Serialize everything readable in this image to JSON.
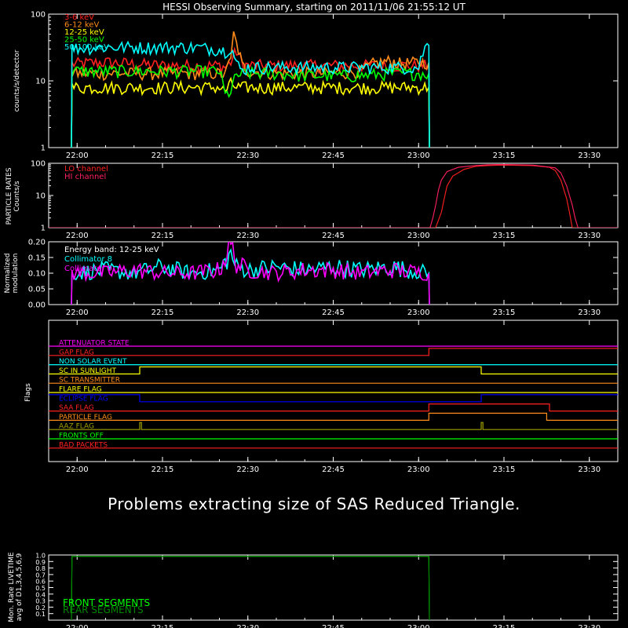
{
  "title": "HESSI Observing Summary, starting on 2011/11/06 21:55:12 UT",
  "message": "Problems extracting size of SAS Reduced Triangle.",
  "time_axis": {
    "start": "21:55:12",
    "ticks": [
      "22:00",
      "22:15",
      "22:30",
      "22:45",
      "23:00",
      "23:15",
      "23:30"
    ]
  },
  "colors": {
    "background": "#000000",
    "axes": "#ffffff",
    "red": "#ff2020",
    "orange": "#ff8c1a",
    "yellow": "#ffff00",
    "green": "#00ff00",
    "cyan": "#00ffff",
    "magenta": "#ff00ff",
    "blue": "#0000ff",
    "olive": "#a0a000"
  },
  "chart_data": [
    {
      "id": "count-rates",
      "type": "line",
      "ylabel": "counts/s/detector",
      "yscale": "log",
      "ylim": [
        1,
        100
      ],
      "yticks": [
        "1",
        "10",
        "100"
      ],
      "x_unit": "minutes after 22:00",
      "series": [
        {
          "name": "3-6 keV",
          "color": "#ff2020",
          "points": [
            [
              -1.0,
              1
            ],
            [
              -0.9,
              18
            ],
            [
              5,
              19
            ],
            [
              10,
              18
            ],
            [
              15,
              17
            ],
            [
              20,
              17
            ],
            [
              25,
              17
            ],
            [
              26,
              16
            ],
            [
              27,
              19
            ],
            [
              28,
              28
            ],
            [
              29,
              18
            ],
            [
              30,
              17
            ],
            [
              35,
              17
            ],
            [
              40,
              17
            ],
            [
              45,
              17
            ],
            [
              50,
              17
            ],
            [
              55,
              17
            ],
            [
              60,
              17
            ],
            [
              61.8,
              17
            ],
            [
              61.9,
              1
            ]
          ]
        },
        {
          "name": "6-12 keV",
          "color": "#ff8c1a",
          "points": [
            [
              -1.0,
              1
            ],
            [
              -0.9,
              13
            ],
            [
              5,
              13
            ],
            [
              10,
              13
            ],
            [
              15,
              13
            ],
            [
              20,
              13
            ],
            [
              25,
              13
            ],
            [
              26,
              12
            ],
            [
              27,
              22
            ],
            [
              27.5,
              55
            ],
            [
              28,
              35
            ],
            [
              29,
              17
            ],
            [
              30,
              14
            ],
            [
              35,
              13
            ],
            [
              40,
              13
            ],
            [
              45,
              13
            ],
            [
              50,
              14
            ],
            [
              52,
              18
            ],
            [
              55,
              20
            ],
            [
              57,
              18
            ],
            [
              60,
              19
            ],
            [
              61.8,
              19
            ],
            [
              61.9,
              1
            ]
          ]
        },
        {
          "name": "12-25 keV",
          "color": "#ffff00",
          "points": [
            [
              -1.0,
              1
            ],
            [
              -0.9,
              8
            ],
            [
              5,
              8
            ],
            [
              10,
              8
            ],
            [
              15,
              8
            ],
            [
              20,
              8
            ],
            [
              25,
              8
            ],
            [
              26,
              7
            ],
            [
              27,
              9
            ],
            [
              28,
              8
            ],
            [
              30,
              8
            ],
            [
              35,
              8
            ],
            [
              40,
              8
            ],
            [
              45,
              8
            ],
            [
              50,
              8
            ],
            [
              55,
              8
            ],
            [
              60,
              8
            ],
            [
              61.8,
              8
            ],
            [
              61.9,
              1
            ]
          ]
        },
        {
          "name": "25-50 keV",
          "color": "#00ff00",
          "points": [
            [
              -1.0,
              1
            ],
            [
              -0.9,
              14
            ],
            [
              5,
              14
            ],
            [
              10,
              14
            ],
            [
              15,
              14
            ],
            [
              20,
              14
            ],
            [
              25,
              14
            ],
            [
              26,
              6
            ],
            [
              27,
              7
            ],
            [
              28,
              12
            ],
            [
              30,
              13
            ],
            [
              35,
              13
            ],
            [
              40,
              12
            ],
            [
              45,
              12
            ],
            [
              50,
              12
            ],
            [
              55,
              13
            ],
            [
              60,
              13
            ],
            [
              61.8,
              13
            ],
            [
              61.9,
              1
            ]
          ]
        },
        {
          "name": "50-100 keV",
          "color": "#00ffff",
          "points": [
            [
              -1.0,
              1
            ],
            [
              -0.9,
              31
            ],
            [
              5,
              32
            ],
            [
              10,
              32
            ],
            [
              15,
              32
            ],
            [
              20,
              32
            ],
            [
              25,
              30
            ],
            [
              26,
              28
            ],
            [
              27,
              32
            ],
            [
              28,
              18
            ],
            [
              29,
              14
            ],
            [
              30,
              16
            ],
            [
              35,
              16
            ],
            [
              40,
              16
            ],
            [
              45,
              16
            ],
            [
              50,
              16
            ],
            [
              55,
              16
            ],
            [
              60,
              16
            ],
            [
              61.5,
              36
            ],
            [
              61.8,
              34
            ],
            [
              61.9,
              1
            ]
          ]
        }
      ]
    },
    {
      "id": "particle-rates",
      "type": "line",
      "ylabel": "PARTICLE RATES\nCounts/s",
      "yscale": "log",
      "ylim": [
        1,
        100
      ],
      "yticks": [
        "1",
        "10",
        "100"
      ],
      "x_unit": "minutes after 22:00",
      "series": [
        {
          "name": "LO channel",
          "color": "#ff2020",
          "points": [
            [
              -5,
              1
            ],
            [
              63,
              1
            ],
            [
              64,
              3
            ],
            [
              64.5,
              8
            ],
            [
              65,
              20
            ],
            [
              66,
              40
            ],
            [
              68,
              65
            ],
            [
              70,
              80
            ],
            [
              72,
              85
            ],
            [
              75,
              88
            ],
            [
              80,
              85
            ],
            [
              83,
              75
            ],
            [
              84,
              60
            ],
            [
              85,
              30
            ],
            [
              86,
              8
            ],
            [
              86.5,
              3
            ],
            [
              87,
              1
            ],
            [
              95,
              1
            ]
          ]
        },
        {
          "name": "HI channel",
          "color": "#ff2060",
          "points": [
            [
              -5,
              1
            ],
            [
              62,
              1
            ],
            [
              62.5,
              2
            ],
            [
              63,
              5
            ],
            [
              63.5,
              15
            ],
            [
              64,
              30
            ],
            [
              65,
              55
            ],
            [
              67,
              75
            ],
            [
              70,
              85
            ],
            [
              72,
              90
            ],
            [
              75,
              92
            ],
            [
              80,
              88
            ],
            [
              84,
              72
            ],
            [
              85,
              50
            ],
            [
              86,
              20
            ],
            [
              87,
              5
            ],
            [
              87.5,
              2
            ],
            [
              88,
              1
            ],
            [
              95,
              1
            ]
          ]
        }
      ]
    },
    {
      "id": "modulation",
      "type": "line",
      "ylabel": "Normalized\nmodulation",
      "ylim": [
        0,
        0.2
      ],
      "yticks": [
        "0.00",
        "0.05",
        "0.10",
        "0.15",
        "0.20"
      ],
      "annotation": "Energy band: 12-25 keV",
      "x_unit": "minutes after 22:00",
      "series": [
        {
          "name": "Collimator 8",
          "color": "#00ffff",
          "points": [
            [
              -1.0,
              0
            ],
            [
              -0.9,
              0.1
            ],
            [
              5,
              0.11
            ],
            [
              10,
              0.1
            ],
            [
              15,
              0.12
            ],
            [
              20,
              0.1
            ],
            [
              25,
              0.11
            ],
            [
              27,
              0.16
            ],
            [
              28,
              0.12
            ],
            [
              30,
              0.11
            ],
            [
              35,
              0.12
            ],
            [
              40,
              0.11
            ],
            [
              45,
              0.12
            ],
            [
              50,
              0.11
            ],
            [
              55,
              0.12
            ],
            [
              61.8,
              0.1
            ],
            [
              61.9,
              0
            ]
          ]
        },
        {
          "name": "Collimator 9",
          "color": "#ff00ff",
          "points": [
            [
              -1.0,
              0
            ],
            [
              -0.9,
              0.1
            ],
            [
              5,
              0.1
            ],
            [
              10,
              0.11
            ],
            [
              15,
              0.1
            ],
            [
              20,
              0.1
            ],
            [
              25,
              0.11
            ],
            [
              27,
              0.19
            ],
            [
              28,
              0.13
            ],
            [
              30,
              0.11
            ],
            [
              35,
              0.1
            ],
            [
              40,
              0.11
            ],
            [
              45,
              0.11
            ],
            [
              50,
              0.1
            ],
            [
              55,
              0.11
            ],
            [
              61.8,
              0.1
            ],
            [
              61.9,
              0
            ]
          ]
        }
      ]
    },
    {
      "id": "flags",
      "type": "line",
      "ylabel": "Flags",
      "x_unit": "minutes after 22:00",
      "series": [
        {
          "name": "ATTENUATOR STATE",
          "color": "#ff00ff",
          "points": [
            [
              -5,
              0
            ],
            [
              95,
              0
            ]
          ]
        },
        {
          "name": "GAP FLAG",
          "color": "#ff2020",
          "points": [
            [
              -5,
              0
            ],
            [
              61.8,
              0
            ],
            [
              61.8,
              1
            ],
            [
              95,
              1
            ]
          ]
        },
        {
          "name": "NON SOLAR EVENT",
          "color": "#00ffff",
          "points": [
            [
              -5,
              0
            ],
            [
              95,
              0
            ]
          ]
        },
        {
          "name": "SC IN SUNLIGHT",
          "color": "#ffff00",
          "points": [
            [
              -5,
              0
            ],
            [
              11,
              0
            ],
            [
              11,
              1
            ],
            [
              71,
              1
            ],
            [
              71,
              0
            ],
            [
              95,
              0
            ]
          ]
        },
        {
          "name": "SC TRANSMITTER",
          "color": "#ff8c1a",
          "points": [
            [
              -5,
              0
            ],
            [
              95,
              0
            ]
          ]
        },
        {
          "name": "FLARE FLAG",
          "color": "#ffff00",
          "points": [
            [
              -5,
              0
            ],
            [
              95,
              0
            ]
          ]
        },
        {
          "name": "ECLIPSE FLAG",
          "color": "#0000ff",
          "points": [
            [
              -5,
              1
            ],
            [
              11,
              1
            ],
            [
              11,
              0
            ],
            [
              71,
              0
            ],
            [
              71,
              1
            ],
            [
              95,
              1
            ]
          ]
        },
        {
          "name": "SAA FLAG",
          "color": "#ff2020",
          "points": [
            [
              -5,
              0
            ],
            [
              61.8,
              0
            ],
            [
              61.8,
              1
            ],
            [
              83,
              1
            ],
            [
              83,
              0
            ],
            [
              95,
              0
            ]
          ]
        },
        {
          "name": "PARTICLE FLAG",
          "color": "#ff8c1a",
          "points": [
            [
              -5,
              0
            ],
            [
              61.8,
              0
            ],
            [
              61.8,
              1
            ],
            [
              82.5,
              1
            ],
            [
              82.5,
              0
            ],
            [
              95,
              0
            ]
          ]
        },
        {
          "name": "AAZ FLAG",
          "color": "#a0a000",
          "points": [
            [
              -5,
              0
            ],
            [
              11,
              0
            ],
            [
              11,
              1
            ],
            [
              11.3,
              1
            ],
            [
              11.3,
              0
            ],
            [
              71,
              0
            ],
            [
              71,
              1
            ],
            [
              71.3,
              1
            ],
            [
              71.3,
              0
            ],
            [
              95,
              0
            ]
          ]
        },
        {
          "name": "FRONTS OFF",
          "color": "#00ff00",
          "points": [
            [
              -5,
              0
            ],
            [
              95,
              0
            ]
          ]
        },
        {
          "name": "BAD PACKETS",
          "color": "#ff2020",
          "points": [
            [
              -5,
              0
            ],
            [
              95,
              0
            ]
          ]
        }
      ]
    },
    {
      "id": "livetime",
      "type": "line",
      "ylabel": "Mon. Rate LIVETIME\navg of D1,3,4,5,6,9",
      "ylim": [
        0,
        1.0
      ],
      "yticks": [
        "0.1",
        "0.2",
        "0.3",
        "0.4",
        "0.5",
        "0.6",
        "0.7",
        "0.8",
        "0.9",
        "1.0"
      ],
      "x_unit": "minutes after 22:00",
      "series": [
        {
          "name": "FRONT SEGMENTS",
          "color": "#00ff00",
          "points": [
            [
              -1.0,
              0
            ],
            [
              -0.9,
              0.98
            ],
            [
              61.8,
              0.98
            ],
            [
              61.9,
              0
            ]
          ]
        },
        {
          "name": "REAR SEGMENTS",
          "color": "#008800",
          "points": [
            [
              -1.0,
              0
            ],
            [
              -0.9,
              0.98
            ],
            [
              61.8,
              0.98
            ],
            [
              61.9,
              0
            ]
          ]
        }
      ]
    }
  ]
}
